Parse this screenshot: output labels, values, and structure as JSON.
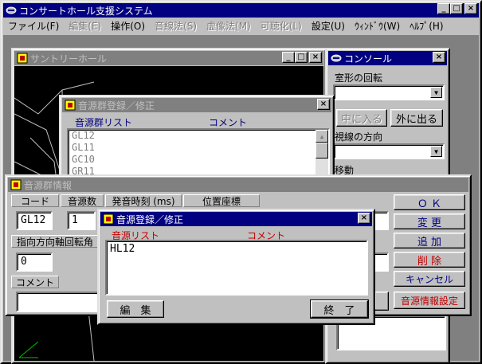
{
  "app": {
    "title": "コンサートホール支援システム",
    "menu": [
      {
        "label": "ファイル(F)",
        "enabled": true
      },
      {
        "label": "編集(E)",
        "enabled": false
      },
      {
        "label": "操作(O)",
        "enabled": true
      },
      {
        "label": "音線法(S)",
        "enabled": false
      },
      {
        "label": "虚像法(M)",
        "enabled": false
      },
      {
        "label": "可聴化(L)",
        "enabled": false
      },
      {
        "label": "設定(U)",
        "enabled": true
      },
      {
        "label": "ｳｨﾝﾄﾞｳ(W)",
        "enabled": true
      },
      {
        "label": "ﾍﾙﾌﾟ(H)",
        "enabled": true
      }
    ]
  },
  "hall_window": {
    "title": "サントリーホール"
  },
  "console": {
    "title": "コンソール",
    "section1": "室形の回転",
    "btn_in": "中に入る",
    "btn_out": "外に出る",
    "section2": "視線の方向",
    "section3": "移動"
  },
  "group_edit": {
    "title": "音源群登録／修正",
    "col_list": "音源群リスト",
    "col_comment": "コメント",
    "items": [
      "GL12",
      "GL11",
      "GC10",
      "GR11"
    ]
  },
  "group_info": {
    "title": "音源群情報",
    "headers": [
      "コード",
      "音源数",
      "発音時刻 (ms)",
      "位置座標"
    ],
    "code_value": "GL12",
    "count_value": "1",
    "direction_label": "指向方向軸回転角",
    "direction_value": "0",
    "comment_label": "コメント",
    "buttons": {
      "ok": "Ｏ Ｋ",
      "change": "変 更",
      "add": "追 加",
      "delete": "削 除",
      "cancel": "キャンセル",
      "source_setting": "音源情報設定"
    }
  },
  "source_edit": {
    "title": "音源登録／修正",
    "col_list": "音源リスト",
    "col_comment": "コメント",
    "items": [
      "HL12"
    ],
    "btn_edit": "編　集",
    "btn_close": "終　了"
  },
  "colors": {
    "titlebar_active": "#000080",
    "titlebar_inactive": "#808080",
    "face": "#c0c0c0",
    "accent_red": "#c00000"
  }
}
